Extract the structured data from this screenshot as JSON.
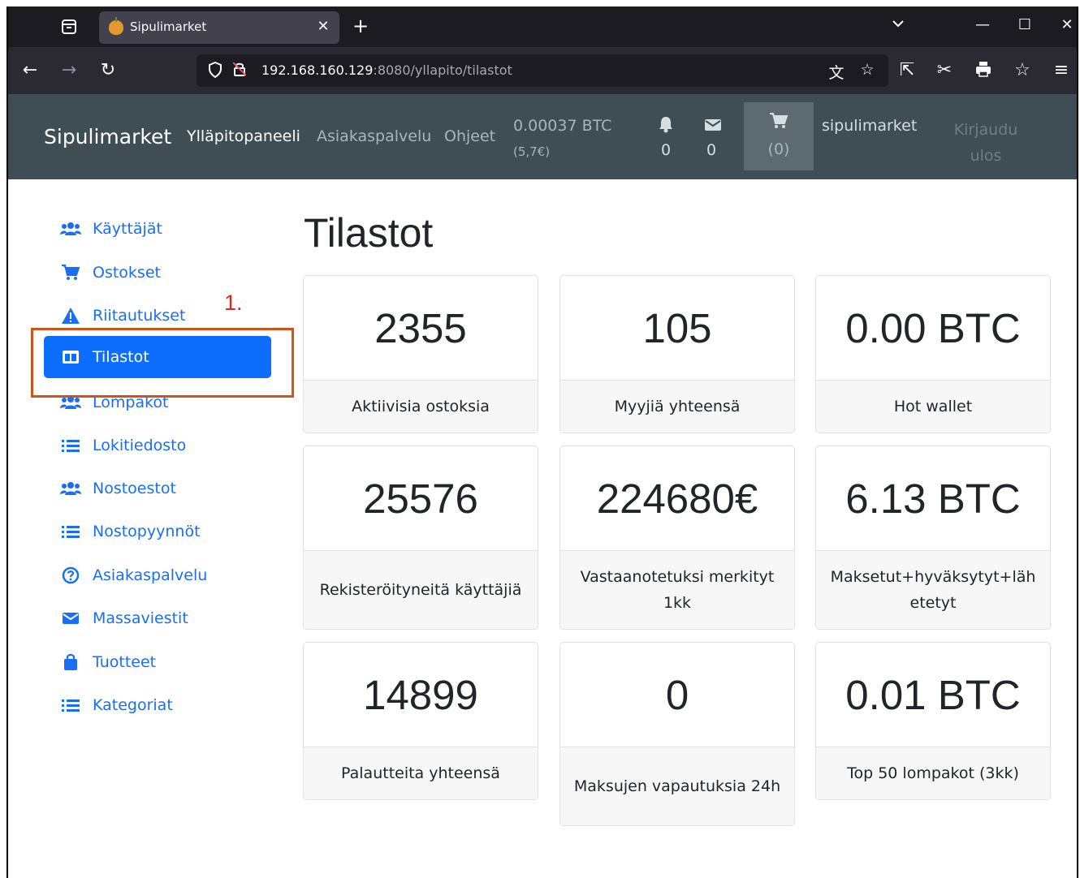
{
  "browser": {
    "tab_title": "Sipulimarket",
    "tab_close": "✕",
    "new_tab": "+",
    "url_host": "192.168.160.129",
    "url_path": ":8080/yllapito/tilastot",
    "window_controls": {
      "minimize": "—",
      "maximize": "☐",
      "close": "✕",
      "list_tabs": "⌄"
    }
  },
  "header": {
    "brand": "Sipulimarket",
    "nav": [
      {
        "label": "Ylläpitopaneeli",
        "active": true
      },
      {
        "label": "Asiakaspalvelu",
        "active": false
      },
      {
        "label": "Ohjeet",
        "active": false
      }
    ],
    "btc_balance": "0.00037 BTC",
    "eur_balance": "(5,7€)",
    "notifications_count": "0",
    "messages_count": "0",
    "cart_count": "(0)",
    "username": "sipulimarket",
    "logout_label": "Kirjaudu ulos"
  },
  "sidebar": {
    "items": [
      {
        "label": "Käyttäjät",
        "icon": "users-icon",
        "active": false
      },
      {
        "label": "Ostokset",
        "icon": "cart-icon",
        "active": false
      },
      {
        "label": "Riitautukset",
        "icon": "warning-icon",
        "active": false
      },
      {
        "label": "Tilastot",
        "icon": "columns-icon",
        "active": true
      },
      {
        "label": "Lompakot",
        "icon": "users-icon",
        "active": false
      },
      {
        "label": "Lokitiedosto",
        "icon": "list-icon",
        "active": false
      },
      {
        "label": "Nostoestot",
        "icon": "users-icon",
        "active": false
      },
      {
        "label": "Nostopyynnöt",
        "icon": "list-icon",
        "active": false
      },
      {
        "label": "Asiakaspalvelu",
        "icon": "question-circle-icon",
        "active": false
      },
      {
        "label": "Massaviestit",
        "icon": "envelope-icon",
        "active": false
      },
      {
        "label": "Tuotteet",
        "icon": "bag-icon",
        "active": false
      },
      {
        "label": "Kategoriat",
        "icon": "list-icon",
        "active": false
      }
    ]
  },
  "annotation": {
    "label": "1.",
    "color": "#e0261f",
    "box_color": "#d2521c"
  },
  "main": {
    "title": "Tilastot",
    "stats": [
      {
        "value": "2355",
        "label": "Aktiivisia ostoksia"
      },
      {
        "value": "105",
        "label": "Myyjiä yhteensä"
      },
      {
        "value": "0.00 BTC",
        "label": "Hot wallet"
      },
      {
        "value": "25576",
        "label": "Rekisteröityneitä käyttäjiä"
      },
      {
        "value": "224680€",
        "label": "Vastaanotetuksi merkityt 1kk"
      },
      {
        "value": "6.13 BTC",
        "label": "Maksetut+hyväksytyt+lähetetyt"
      },
      {
        "value": "14899",
        "label": "Palautteita yhteensä"
      },
      {
        "value": "0",
        "label": "Maksujen vapautuksia 24h"
      },
      {
        "value": "0.01 BTC",
        "label": "Top 50 lompakot (3kk)"
      }
    ]
  },
  "colors": {
    "header_bg": "#3f4e55",
    "primary": "#0d6efd",
    "link": "#1a6ef5"
  }
}
